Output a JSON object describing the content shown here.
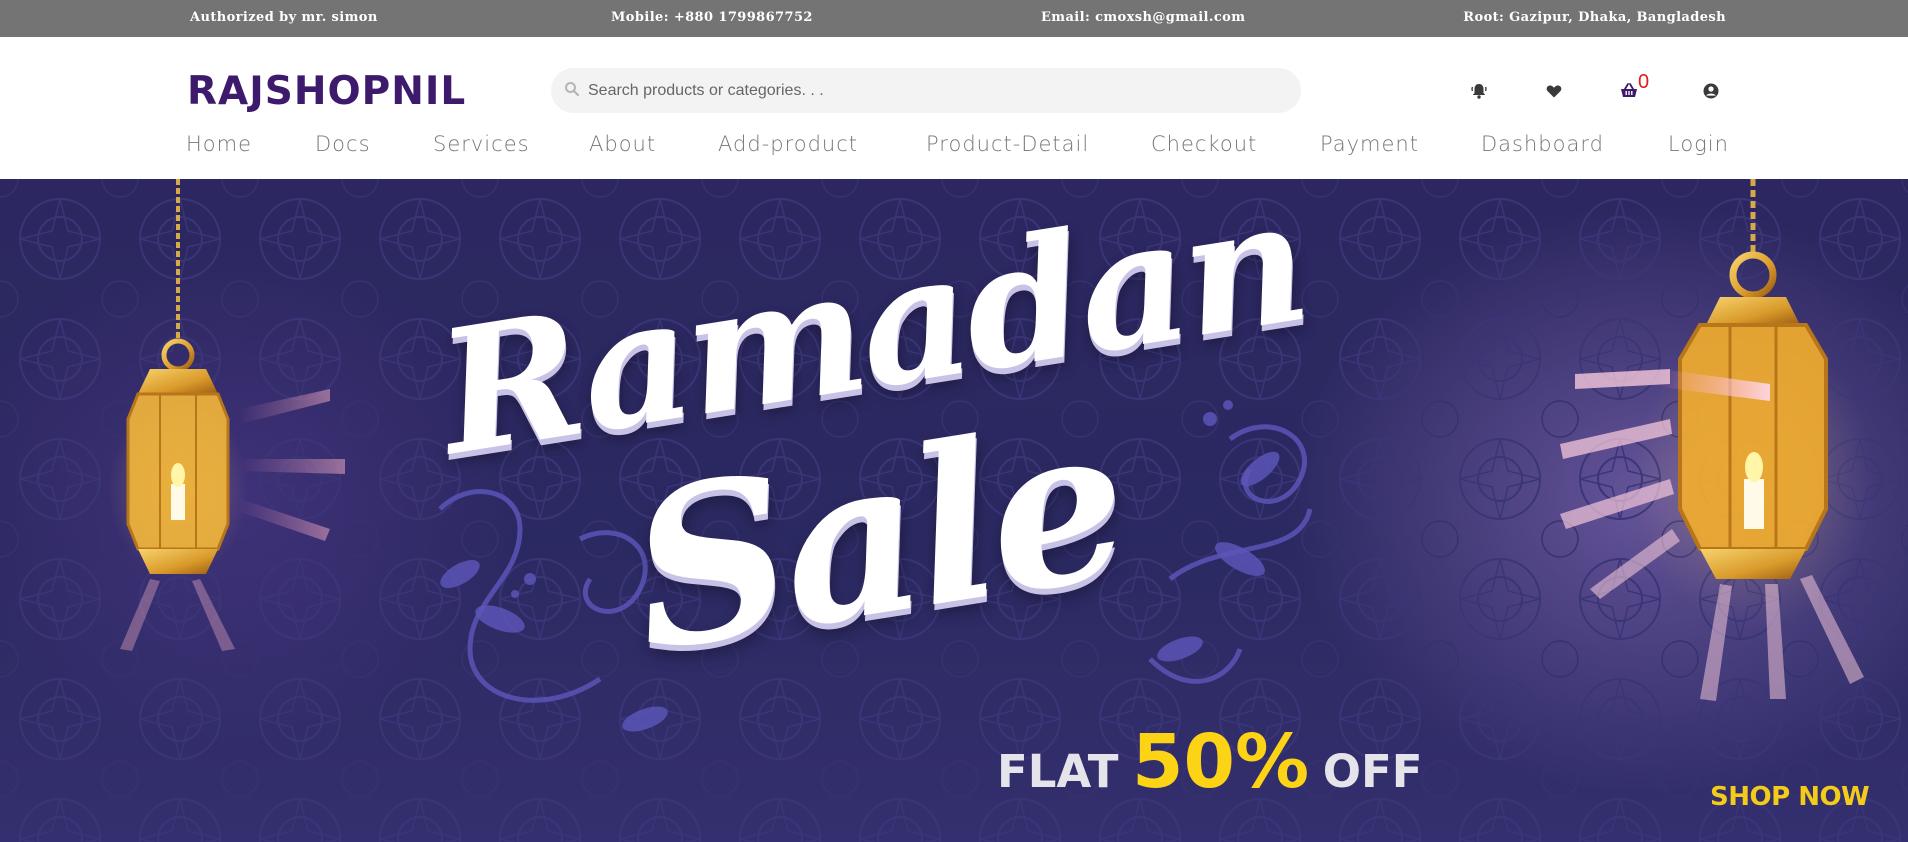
{
  "topbar": {
    "author": "Authorized by mr. simon",
    "mobile": "Mobile: +880 1799867752",
    "email": "Email: cmoxsh@gmail.com",
    "root": "Root: Gazipur, Dhaka, Bangladesh"
  },
  "header": {
    "logo": "RAJSHOPNIL",
    "search_placeholder": "Search products or categories. . .",
    "cart_count": "0",
    "icons": [
      "bell-icon",
      "heart-icon",
      "cart-icon",
      "user-icon"
    ]
  },
  "nav": {
    "items": [
      {
        "label": "Home"
      },
      {
        "label": "Docs"
      },
      {
        "label": "Services"
      },
      {
        "label": "About"
      },
      {
        "label": "Add-product"
      },
      {
        "label": "Product-Detail"
      },
      {
        "label": "Checkout"
      },
      {
        "label": "Payment"
      },
      {
        "label": "Dashboard"
      },
      {
        "label": "Login"
      }
    ]
  },
  "banner": {
    "title_line1": "Ramadan",
    "title_line2": "Sale",
    "offer_prefix": "FLAT",
    "offer_value": "50%",
    "offer_suffix": "OFF",
    "cta": "SHOP NOW"
  },
  "colors": {
    "topbar_bg": "#747474",
    "logo": "#3d1a6b",
    "banner_bg": "#2b2961",
    "accent_yellow": "#fcd315",
    "cart_badge": "#e21b1b"
  }
}
